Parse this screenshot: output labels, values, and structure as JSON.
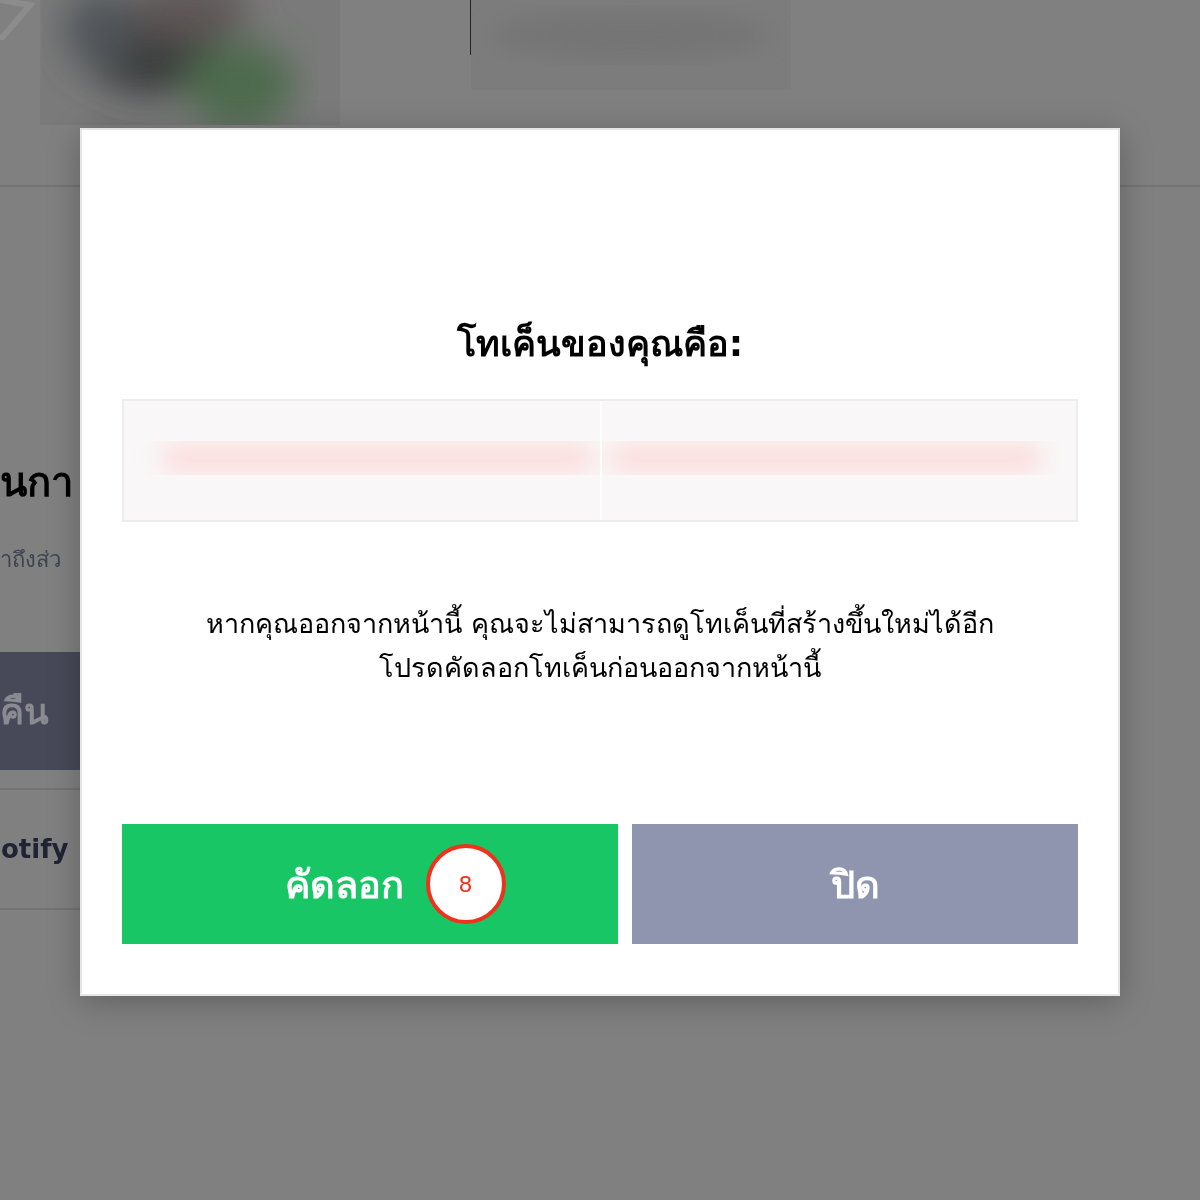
{
  "background": {
    "title_fragment": "นกา",
    "subtitle_fragment": "าถึงส่ว",
    "button_fragment": "คืน",
    "item_fragment": "otify"
  },
  "dialog": {
    "title": "โทเค็นของคุณคือ:",
    "message_lines": [
      "หากคุณออกจากหน้านี้ คุณจะไม่สามารถดูโทเค็นที่สร้างขึ้นใหม่ได้อีก",
      "โปรดคัดลอกโทเค็นก่อนออกจากหน้านี้"
    ],
    "buttons": [
      {
        "label": "คัดลอก",
        "kind": "primary",
        "badge": "8"
      },
      {
        "label": "ปิด",
        "kind": "secondary"
      }
    ]
  }
}
